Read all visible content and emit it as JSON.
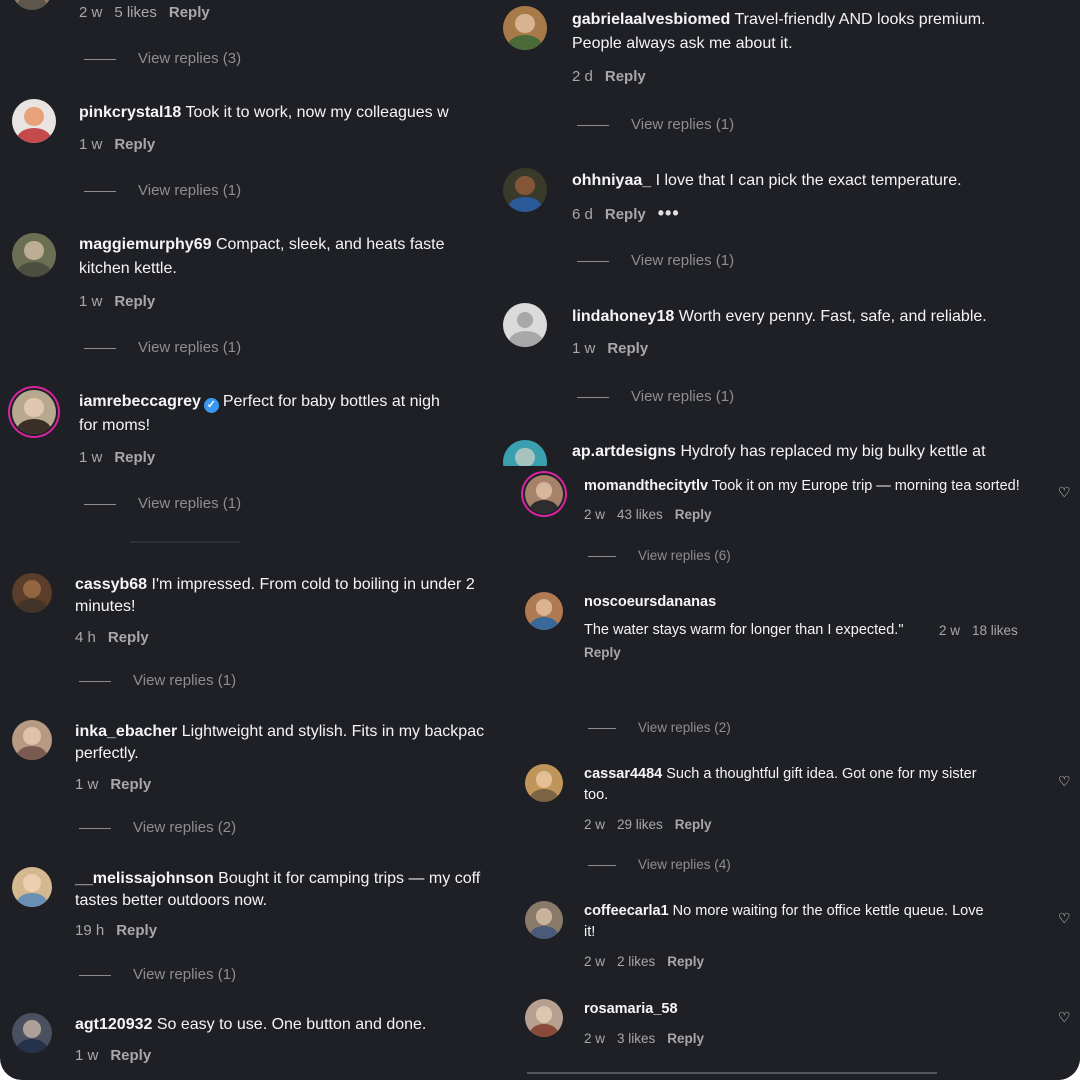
{
  "left_column": {
    "top_meta": {
      "time": "2 w",
      "likes": "5 likes",
      "reply": "Reply"
    },
    "top_view_replies": "View replies (3)",
    "comments": [
      {
        "username": "pinkcrystal18",
        "text": "Took it to work, now my colleagues w",
        "time": "1 w",
        "reply": "Reply",
        "view_replies": "View replies (1)"
      },
      {
        "username": "maggiemurphy69",
        "text": "Compact, sleek, and heats faste",
        "text2": "kitchen kettle.",
        "time": "1 w",
        "reply": "Reply",
        "view_replies": "View replies (1)"
      },
      {
        "username": "iamrebeccagrey",
        "text": "Perfect for baby bottles at nigh",
        "text2": "for moms!",
        "time": "1 w",
        "reply": "Reply",
        "view_replies": "View replies (1)"
      },
      {
        "username": "cassyb68",
        "text": "I'm impressed. From cold to boiling in under 2",
        "text2": "minutes!",
        "time": "4 h",
        "reply": "Reply",
        "view_replies": "View replies (1)"
      },
      {
        "username": "inka_ebacher",
        "text": "Lightweight and stylish. Fits in my backpac",
        "text2": "perfectly.",
        "time": "1 w",
        "reply": "Reply",
        "view_replies": "View replies (2)"
      },
      {
        "username": "__melissajohnson",
        "text": "Bought it for camping trips — my coff",
        "text2": "tastes better outdoors now.",
        "time": "19 h",
        "reply": "Reply",
        "view_replies": "View replies (1)"
      },
      {
        "username": "agt120932",
        "text": "So easy to use. One button and done.",
        "time": "1 w",
        "reply": "Reply"
      }
    ]
  },
  "right_column": {
    "comments": [
      {
        "username": "gabrielaalvesbiomed",
        "text": "Travel-friendly AND looks premium.",
        "text2": "People always ask me about it.",
        "time": "2 d",
        "reply": "Reply",
        "view_replies": "View replies (1)"
      },
      {
        "username": "ohhniyaa_",
        "text": "I love that I can pick the exact temperature.",
        "time": "6 d",
        "reply": "Reply",
        "more": "•••",
        "view_replies": "View replies (1)"
      },
      {
        "username": "lindahoney18",
        "text": "Worth every penny. Fast, safe, and reliable.",
        "time": "1 w",
        "reply": "Reply",
        "view_replies": "View replies (1)"
      },
      {
        "username": "ap.artdesigns",
        "text": "Hydrofy has replaced my big bulky kettle at"
      }
    ]
  },
  "overlay_column": {
    "comments": [
      {
        "username": "momandthecitytlv",
        "text": "Took it on my Europe trip — morning tea sorted!",
        "time": "2 w",
        "likes": "43 likes",
        "reply": "Reply",
        "view_replies": "View replies (6)"
      },
      {
        "username": "noscoeursdananas",
        "text": "The water stays warm for longer than I expected.\"",
        "time": "2 w",
        "likes": "18 likes",
        "reply": "Reply",
        "view_replies": "View replies (2)"
      },
      {
        "username": "cassar4484",
        "text": "Such a thoughtful gift idea. Got one for my sister",
        "text2": "too.",
        "time": "2 w",
        "likes": "29 likes",
        "reply": "Reply",
        "view_replies": "View replies (4)"
      },
      {
        "username": "coffeecarla1",
        "text": "No more waiting for the office kettle queue. Love",
        "text2": "it!",
        "time": "2 w",
        "likes": "2 likes",
        "reply": "Reply"
      },
      {
        "username": "rosamaria_58",
        "time": "2 w",
        "likes": "3 likes",
        "reply": "Reply"
      }
    ]
  },
  "colors": {
    "background": "#1f2025",
    "text": "#f5f5f5",
    "muted": "#a8a8a8",
    "verified": "#3897f0",
    "story_ring": "#d6249f"
  }
}
